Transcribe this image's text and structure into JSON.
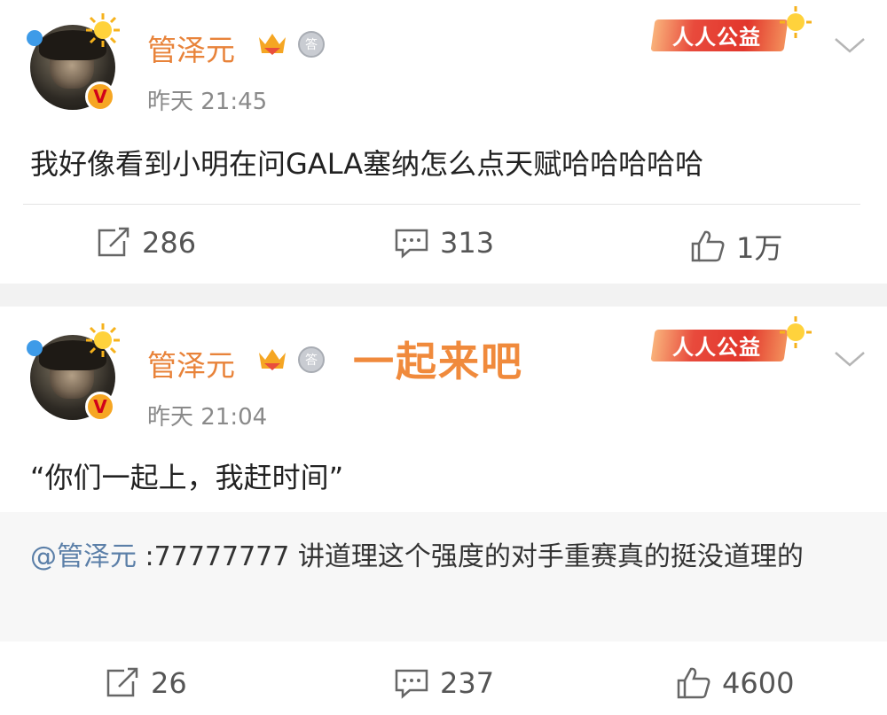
{
  "posts": [
    {
      "username": "管泽元",
      "timestamp": "昨天 21:45",
      "banner_label": "人人公益",
      "text": "我好像看到小明在问GALA塞纳怎么点天赋哈哈哈哈哈",
      "actions": {
        "repost_count": "286",
        "comment_count": "313",
        "like_count": "1万"
      }
    },
    {
      "username": "管泽元",
      "timestamp": "昨天 21:04",
      "banner_label": "人人公益",
      "overlay_caption": "一起来吧",
      "text": "“你们一起上，我赶时间”",
      "repost": {
        "mention": "@管泽元",
        "text": " :77777777 讲道理这个强度的对手重赛真的挺没道理的"
      },
      "actions": {
        "repost_count": "26",
        "comment_count": "237",
        "like_count": "4600"
      }
    }
  ],
  "colors": {
    "username": "#e8833a",
    "caption": "#f08a3c",
    "mention": "#5b7fa8",
    "background": "#ffffff",
    "separator": "#f2f2f2"
  },
  "icons": [
    "avatar",
    "v-badge",
    "sun-icon",
    "crown-icon",
    "medal-icon",
    "charity-banner",
    "chevron-down-icon",
    "repost-icon",
    "comment-icon",
    "like-icon"
  ]
}
